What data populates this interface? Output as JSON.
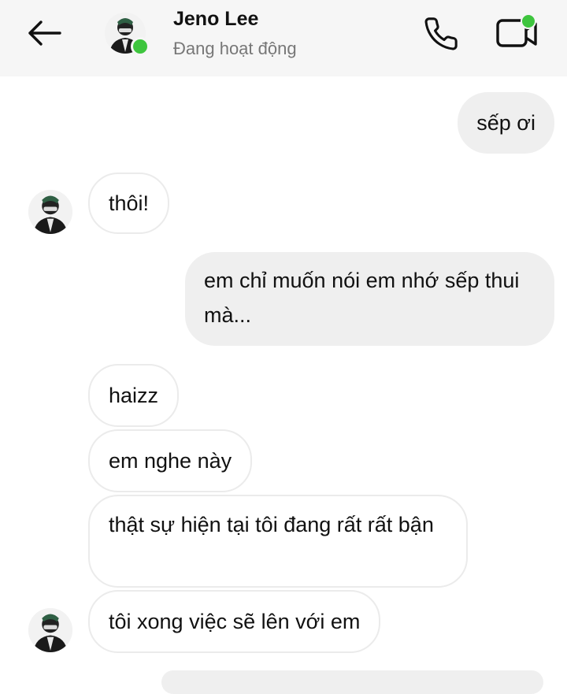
{
  "header": {
    "contact_name": "Jeno Lee",
    "status": "Đang hoạt động",
    "icons": {
      "back": "arrow-left-icon",
      "call": "phone-icon",
      "video": "video-call-icon"
    },
    "online_color": "#3ec53e"
  },
  "messages": [
    {
      "direction": "outgoing",
      "text": "sếp ơi"
    },
    {
      "direction": "incoming",
      "text": "thôi!"
    },
    {
      "direction": "outgoing",
      "text": "em chỉ muốn nói em nhớ sếp thui mà..."
    },
    {
      "direction": "incoming",
      "text": "haizz"
    },
    {
      "direction": "incoming",
      "text": "em nghe này"
    },
    {
      "direction": "incoming",
      "text": "thật sự hiện tại tôi đang rất rất bận"
    },
    {
      "direction": "incoming",
      "text": "tôi xong việc sẽ lên với em"
    }
  ]
}
